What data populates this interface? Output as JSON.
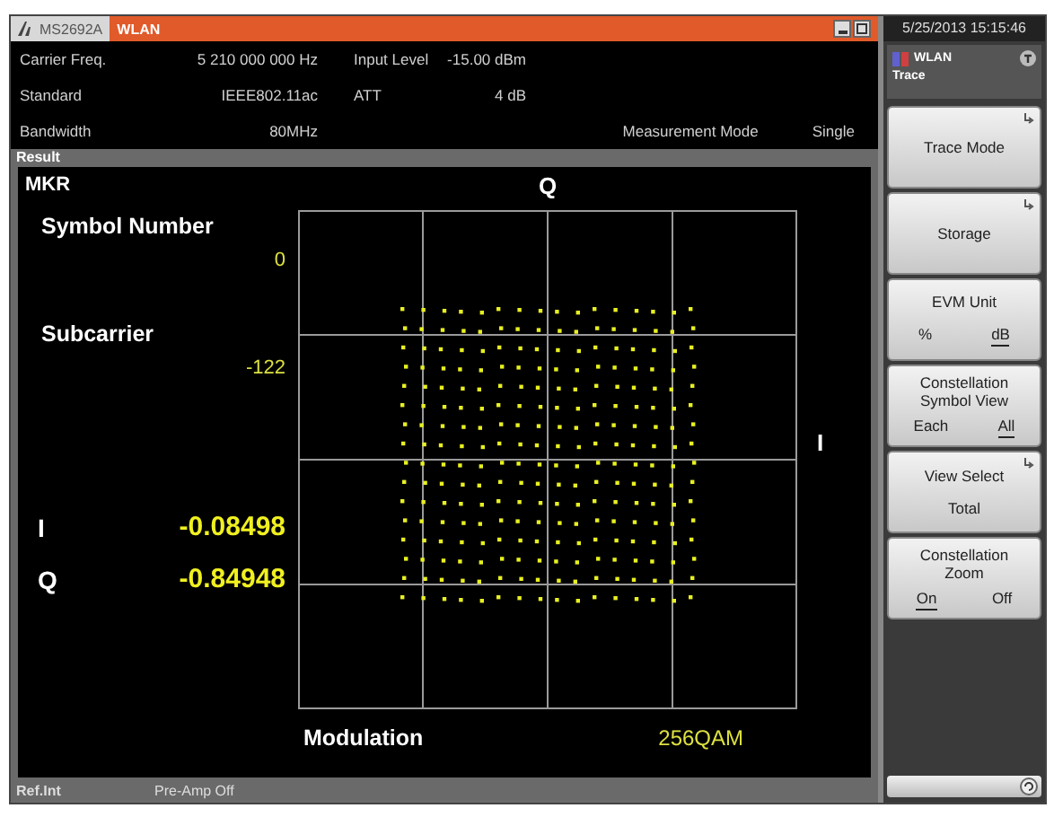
{
  "window": {
    "model": "MS2692A",
    "title": "WLAN"
  },
  "settings": [
    {
      "label": "Carrier Freq.",
      "value": "5 210 000 000 Hz"
    },
    {
      "label": "Standard",
      "value": "IEEE802.11ac"
    },
    {
      "label": "Bandwidth",
      "value": "80MHz"
    },
    {
      "label": "Input Level",
      "value": "-15.00 dBm"
    },
    {
      "label": "ATT",
      "value": "4 dB"
    }
  ],
  "measurement_mode": {
    "label": "Measurement Mode",
    "value": "Single"
  },
  "result": {
    "title": "Result",
    "marker_label": "MKR",
    "symbol_number_label": "Symbol Number",
    "symbol_number": "0",
    "subcarrier_label": "Subcarrier",
    "subcarrier": "-122",
    "i_label": "I",
    "i_value": "-0.08498",
    "q_label": "Q",
    "q_value": "-0.84948",
    "modulation_label": "Modulation",
    "modulation": "256QAM"
  },
  "constellation": {
    "q_axis": "Q",
    "i_axis": "I"
  },
  "status_bar": {
    "reference": "Ref.Int",
    "preamp": "Pre-Amp Off"
  },
  "side": {
    "datetime": "5/25/2013 15:15:46",
    "app": "WLAN",
    "menu_title": "Trace"
  },
  "menu": [
    {
      "kind": "plain",
      "label": "Trace Mode",
      "submenu": true
    },
    {
      "kind": "plain",
      "label": "Storage",
      "submenu": true
    },
    {
      "kind": "toggle",
      "label": "EVM Unit",
      "submenu": false,
      "options": [
        {
          "label": "%",
          "selected": false
        },
        {
          "label": "dB",
          "selected": true
        }
      ]
    },
    {
      "kind": "toggle",
      "label": "Constellation Symbol View",
      "submenu": false,
      "options": [
        {
          "label": "Each",
          "selected": false
        },
        {
          "label": "All",
          "selected": true
        }
      ]
    },
    {
      "kind": "value",
      "label": "View Select",
      "value": "Total",
      "submenu": true
    },
    {
      "kind": "toggle",
      "label": "Constellation Zoom",
      "submenu": false,
      "options": [
        {
          "label": "On",
          "selected": true
        },
        {
          "label": "Off",
          "selected": false
        }
      ]
    }
  ]
}
